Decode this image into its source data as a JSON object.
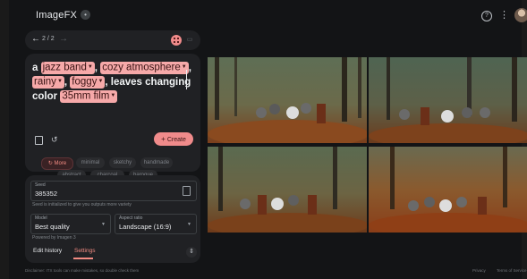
{
  "app": {
    "title": "ImageFX",
    "badge": "•"
  },
  "header": {
    "help_icon": "help-icon",
    "more_icon": "more-vert-icon"
  },
  "nav": {
    "back": "←",
    "count": "2 / 2",
    "forward": "→"
  },
  "prompt": {
    "a": "a",
    "chip1": "jazz band",
    "sep1": ",",
    "chip2": "cozy atmosphere",
    "sep2": ",",
    "chip3": "rainy",
    "sep3": ",",
    "chip4": "foggy",
    "mid": ", leaves changing color",
    "chip5": "35mm film",
    "dropdown_glyph": "▼"
  },
  "actions": {
    "create": "Create",
    "create_plus": "+"
  },
  "style_chips": {
    "more": "More",
    "minimal": "minimal",
    "sketchy": "sketchy",
    "handmade": "handmade",
    "abstract": "abstract",
    "charcoal": "charcoal",
    "baroque": "baroque"
  },
  "settings": {
    "seed_label": "Seed",
    "seed_value": "385352",
    "seed_help": "Seed is initialized to give you outputs more variety",
    "model_label": "Model",
    "model_value": "Best quality",
    "aspect_label": "Aspect ratio",
    "aspect_value": "Landscape (16:9)",
    "powered_by": "Powered by Imagen 3",
    "arrow": "▼"
  },
  "tabs": {
    "edit_history": "Edit history",
    "settings": "Settings"
  },
  "footer": {
    "disclaimer": "Disclaimer: ITX tools can make mistakes, so double check them",
    "privacy": "Privacy",
    "terms": "Terms of Service"
  },
  "colors": {
    "accent": "#f28b82",
    "chip_bg": "#f6a9a9",
    "panel_bg": "#202124"
  }
}
